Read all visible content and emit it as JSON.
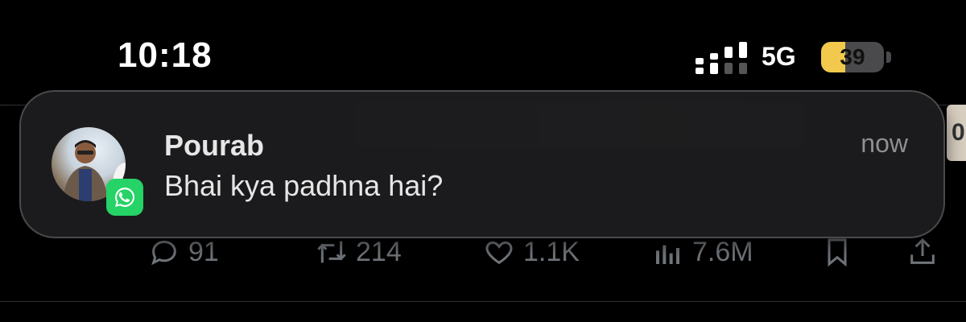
{
  "status_bar": {
    "time": "10:18",
    "network": "5G",
    "battery_level": "39",
    "battery_fraction": 0.39,
    "battery_color": "#f2c94c"
  },
  "notification": {
    "app_icon": "whatsapp-icon",
    "sender": "Pourab",
    "message": "Bhai kya padhna hai?",
    "time": "now",
    "app_color": "#25d366"
  },
  "tweet": {
    "media_edge_text": "0",
    "actions": {
      "replies": "91",
      "reposts": "214",
      "likes": "1.1K",
      "views": "7.6M"
    },
    "icons": [
      "reply-icon",
      "repost-icon",
      "like-icon",
      "views-icon",
      "bookmark-icon",
      "share-icon"
    ]
  }
}
